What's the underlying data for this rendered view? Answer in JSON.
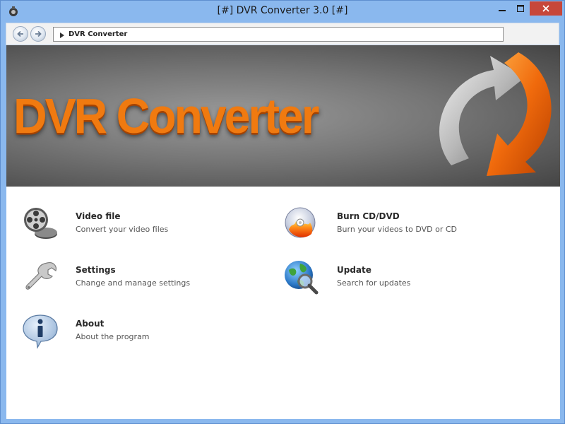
{
  "window": {
    "title": "[#] DVR Converter 3.0 [#]",
    "icons": {
      "app": "app-logo-icon",
      "minimize": "minimize-icon",
      "maximize": "maximize-icon",
      "close": "close-icon"
    }
  },
  "navbar": {
    "back_icon": "back-arrow-icon",
    "forward_icon": "forward-arrow-icon",
    "breadcrumb": "DVR Converter"
  },
  "banner": {
    "title": "DVR Converter",
    "logo_icon": "circular-arrows-icon"
  },
  "menu": {
    "video_file": {
      "title": "Video file",
      "description": "Convert your video files",
      "icon": "film-reel-icon"
    },
    "settings": {
      "title": "Settings",
      "description": "Change and manage settings",
      "icon": "wrench-icon"
    },
    "about": {
      "title": "About",
      "description": "About the program",
      "icon": "info-icon"
    },
    "burn": {
      "title": "Burn CD/DVD",
      "description": "Burn your videos to DVD or CD",
      "icon": "burning-disc-icon"
    },
    "update": {
      "title": "Update",
      "description": "Search for updates",
      "icon": "globe-search-icon"
    }
  },
  "colors": {
    "titlebar": "#8ab8ee",
    "close_button": "#c7473a",
    "brand_orange": "#f07a10"
  }
}
